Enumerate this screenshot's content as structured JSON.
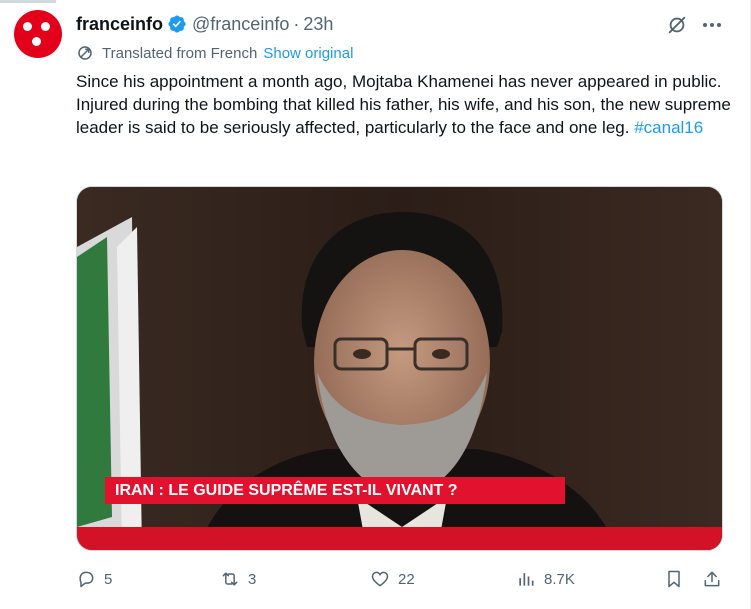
{
  "tweet": {
    "display_name": "franceinfo",
    "handle": "@franceinfo",
    "separator": "·",
    "time": "23h",
    "translation_label": "Translated from French",
    "translation_link": "Show original",
    "text_main": "Since his appointment a month ago, Mojtaba Khamenei has never appeared in public. Injured during the bombing that killed his father, his wife, and his son, the new supreme leader is said to be seriously affected, particularly to the face and one leg.",
    "hashtag": "#canal16",
    "media_banner": "IRAN : LE GUIDE SUPRÊME EST-IL VIVANT ?"
  },
  "actions": {
    "replies": "5",
    "reposts": "3",
    "likes": "22",
    "views": "8.7K"
  },
  "icons": {
    "avatar": "franceinfo-logo",
    "verified": "verified-badge-icon",
    "grok": "grok-icon",
    "more": "more-icon",
    "translate": "translate-icon",
    "reply": "reply-icon",
    "repost": "repost-icon",
    "like": "heart-icon",
    "views": "views-icon",
    "bookmark": "bookmark-icon",
    "share": "share-icon"
  },
  "colors": {
    "brand_red": "#e3001b",
    "link_blue": "#1d9bf0",
    "muted": "#536471",
    "text": "#0f1419"
  }
}
